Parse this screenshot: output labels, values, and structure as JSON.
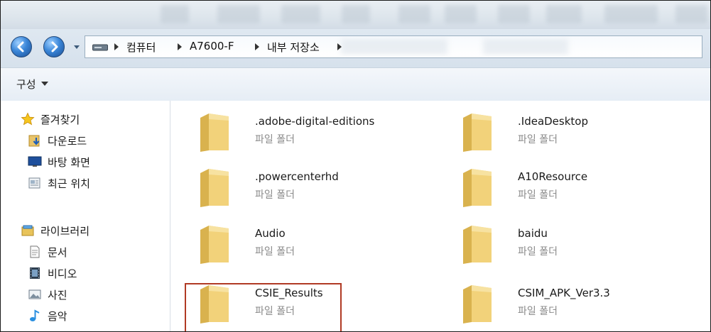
{
  "address_bar": {
    "path": [
      "컴퓨터",
      "A7600-F",
      "내부 저장소"
    ]
  },
  "toolbar": {
    "organize_label": "구성"
  },
  "sidebar": {
    "favorites": {
      "label": "즐겨찾기",
      "items": [
        {
          "label": "다운로드",
          "icon": "download-folder-icon"
        },
        {
          "label": "바탕 화면",
          "icon": "desktop-icon"
        },
        {
          "label": "최근 위치",
          "icon": "recent-places-icon"
        }
      ]
    },
    "libraries": {
      "label": "라이브러리",
      "items": [
        {
          "label": "문서",
          "icon": "document-icon"
        },
        {
          "label": "비디오",
          "icon": "video-icon"
        },
        {
          "label": "사진",
          "icon": "picture-icon"
        },
        {
          "label": "음악",
          "icon": "music-icon"
        }
      ]
    }
  },
  "folders": [
    {
      "name": ".adobe-digital-editions",
      "type": "파일 폴더"
    },
    {
      "name": ".IdeaDesktop",
      "type": "파일 폴더"
    },
    {
      "name": ".powercenterhd",
      "type": "파일 폴더"
    },
    {
      "name": "A10Resource",
      "type": "파일 폴더"
    },
    {
      "name": "Audio",
      "type": "파일 폴더"
    },
    {
      "name": "baidu",
      "type": "파일 폴더"
    },
    {
      "name": "CSIE_Results",
      "type": "파일 폴더",
      "highlighted": true
    },
    {
      "name": "CSIM_APK_Ver3.3",
      "type": "파일 폴더"
    }
  ],
  "colors": {
    "highlight_border": "#b03a24",
    "secondary_text": "#8a8a8a",
    "folder_yellow": "#f2d27a"
  }
}
